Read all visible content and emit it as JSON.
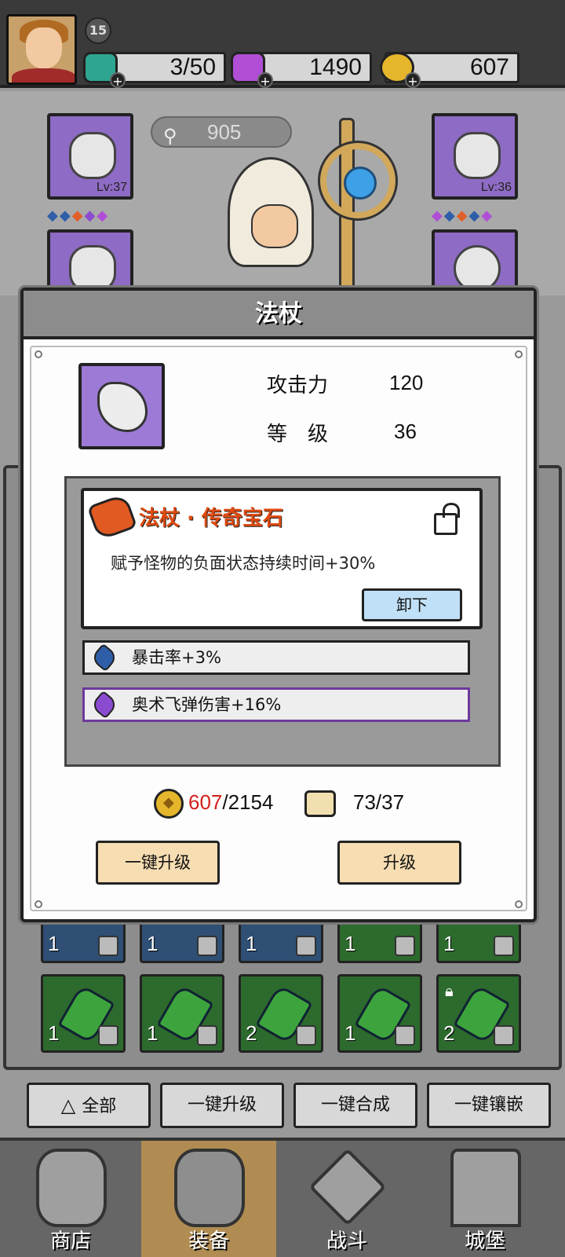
{
  "topbar": {
    "player_level": "15",
    "energy": "3/50",
    "gems": "1490",
    "gold": "607"
  },
  "hero": {
    "power": "905",
    "left_slots": [
      {
        "level": "Lv:37"
      }
    ],
    "right_slots": [
      {
        "level": "Lv:36"
      }
    ]
  },
  "modal": {
    "title": "法杖",
    "stats": [
      {
        "label": "攻击力",
        "value": "120"
      },
      {
        "label": "等　级",
        "value": "36"
      }
    ],
    "legend_gem": {
      "title": "法杖 · 传奇宝石",
      "description": "赋予怪物的负面状态持续时间+30%",
      "unequip_label": "卸下"
    },
    "sub_stats": [
      {
        "text": "暴击率+3%",
        "gem_color": "#2f5ea8"
      },
      {
        "text": "奥术飞弹伤害+16%",
        "gem_color": "#8a4bd1"
      }
    ],
    "cost": {
      "gold_have": "607",
      "gold_need": "/2154",
      "scroll": "73/37"
    },
    "one_click_upgrade_label": "一键升级",
    "upgrade_label": "升级"
  },
  "inventory": {
    "rows": [
      [
        {
          "count": "1",
          "color": "blue"
        },
        {
          "count": "1",
          "color": "blue"
        },
        {
          "count": "1",
          "color": "blue"
        },
        {
          "count": "1",
          "color": "green"
        },
        {
          "count": "1",
          "color": "green"
        }
      ],
      [
        {
          "count": "1",
          "color": "green"
        },
        {
          "count": "1",
          "color": "green"
        },
        {
          "count": "2",
          "color": "green"
        },
        {
          "count": "1",
          "color": "green"
        },
        {
          "count": "2",
          "color": "green"
        }
      ]
    ]
  },
  "actions": {
    "all_label": "全部",
    "upgrade_all_label": "一键升级",
    "merge_all_label": "一键合成",
    "inlay_all_label": "一键镶嵌"
  },
  "nav": {
    "shop": "商店",
    "equip": "装备",
    "battle": "战斗",
    "castle": "城堡"
  }
}
